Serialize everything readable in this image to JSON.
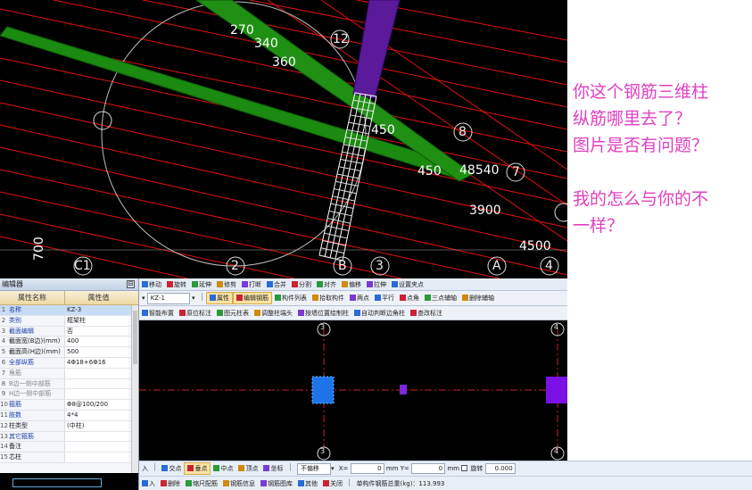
{
  "view3d": {
    "dim_labels": [
      "270",
      "340",
      "360",
      "450",
      "450",
      "48540",
      "3900",
      "4500",
      "700"
    ],
    "axis_labels": [
      "12",
      "8",
      "7",
      "C1",
      "2",
      "B",
      "3",
      "A",
      "4"
    ]
  },
  "note": {
    "lines": [
      "你这个钢筋三维柱",
      "纵筋哪里去了？",
      "图片是否有问题？",
      "",
      "我的怎么与你的不",
      "一样？"
    ]
  },
  "props": {
    "title": "编辑器",
    "col_name": "属性名称",
    "col_value": "属性值",
    "rows": [
      {
        "idx": "1",
        "name": "名称",
        "value": "KZ-3",
        "style": "blue",
        "selected": true
      },
      {
        "idx": "2",
        "name": "类别",
        "value": "框架柱",
        "style": "blue"
      },
      {
        "idx": "3",
        "name": "截面编辑",
        "value": "否",
        "style": "blue"
      },
      {
        "idx": "4",
        "name": "截面宽(B边)(mm)",
        "value": "400",
        "style": "black"
      },
      {
        "idx": "5",
        "name": "截面高(H边)(mm)",
        "value": "500",
        "style": "black"
      },
      {
        "idx": "6",
        "name": "全部纵筋",
        "value": "4Φ18+6Φ16",
        "style": "blue"
      },
      {
        "idx": "7",
        "name": "角筋",
        "value": "",
        "style": "gray"
      },
      {
        "idx": "8",
        "name": "B边一侧中部筋",
        "value": "",
        "style": "gray"
      },
      {
        "idx": "9",
        "name": "H边一侧中部筋",
        "value": "",
        "style": "gray"
      },
      {
        "idx": "10",
        "name": "箍筋",
        "value": "Φ8@100/200",
        "style": "blue"
      },
      {
        "idx": "11",
        "name": "肢数",
        "value": "4*4",
        "style": "blue"
      },
      {
        "idx": "12",
        "name": "柱类型",
        "value": "(中柱)",
        "style": "black"
      },
      {
        "idx": "13",
        "name": "其它箍筋",
        "value": "",
        "style": "blue"
      },
      {
        "idx": "14",
        "name": "备注",
        "value": "",
        "style": "black"
      },
      {
        "idx": "15",
        "name": "芯柱",
        "value": "",
        "style": "black"
      }
    ]
  },
  "toolbar1": {
    "items": [
      "移动",
      "旋转",
      "延伸",
      "修剪",
      "打断",
      "合并",
      "分割",
      "对齐",
      "偏移",
      "拉伸",
      "设置夹点"
    ]
  },
  "toolbar2": {
    "component": "KZ-1",
    "items": [
      "属性",
      "编辑钢筋",
      "构件列表",
      "拾取构件",
      "两点",
      "平行",
      "点角",
      "三点辅轴",
      "删除辅轴"
    ]
  },
  "toolbar3": {
    "items": [
      "智能布置",
      "原位标注",
      "图元柱表",
      "调整柱端头",
      "按墙位置绘制柱",
      "自动判断边角柱",
      "查改标注"
    ]
  },
  "view2d": {
    "axis_labels": [
      "3",
      "4",
      "3",
      "4"
    ],
    "colors": {
      "left_col": "#1e73e8",
      "small": "#7a28d8",
      "right_col": "#7a10e6",
      "grid": "#cc2020"
    }
  },
  "snapbar": {
    "left_label": "入",
    "items": [
      "交点",
      "垂点",
      "中点",
      "顶点",
      "坐标"
    ],
    "offset_mode": "不偏移",
    "x_label": "X=",
    "x_value": "0",
    "y_label": "mm Y=",
    "y_value": "0",
    "unit": "mm",
    "rotate_label": "旋转",
    "rotate_value": "0.000"
  },
  "statusbar": {
    "items": [
      "入",
      "删除",
      "缩尺配筋",
      "钢筋信息",
      "钢筋图库",
      "其他",
      "关闭"
    ],
    "total": "单构件钢筋总重(kg)：113.993"
  }
}
